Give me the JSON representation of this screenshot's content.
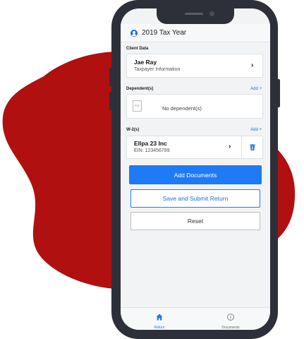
{
  "colors": {
    "accent": "#1f7af5",
    "blob": "#b0100f",
    "device": "#2e3039"
  },
  "header": {
    "title": "2019 Tax Year",
    "icon": "user-circle-icon"
  },
  "client": {
    "section_label": "Client Data",
    "name": "Jae Ray",
    "subtitle": "Taxpayer Information"
  },
  "dependents": {
    "section_label": "Dependent(s)",
    "add_label": "Add +",
    "empty_text": "No dependent(s)",
    "icon_text": "PDF"
  },
  "w2": {
    "section_label": "W-2(s)",
    "add_label": "Add +",
    "employer": "Ellpa 23 Inc",
    "ein": "EIN: 123456789"
  },
  "buttons": {
    "add_documents": "Add Documents",
    "save_submit": "Save and Submit Return",
    "reset": "Reset"
  },
  "tabs": [
    {
      "label": "Return",
      "icon": "home-icon",
      "active": true
    },
    {
      "label": "Documents",
      "icon": "info-icon",
      "active": false
    }
  ]
}
